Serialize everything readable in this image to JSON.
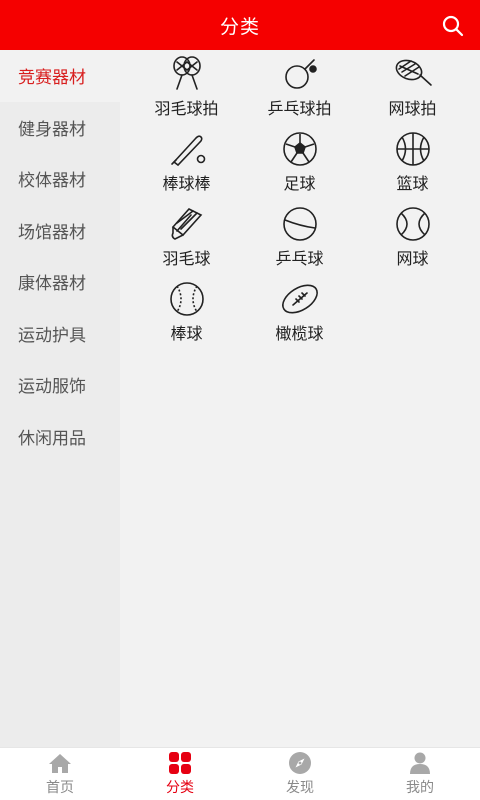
{
  "header": {
    "title": "分类",
    "search_icon": "search-icon"
  },
  "sidebar": {
    "items": [
      {
        "label": "竞赛器材",
        "active": true
      },
      {
        "label": "健身器材",
        "active": false
      },
      {
        "label": "校体器材",
        "active": false
      },
      {
        "label": "场馆器材",
        "active": false
      },
      {
        "label": "康体器材",
        "active": false
      },
      {
        "label": "运动护具",
        "active": false
      },
      {
        "label": "运动服饰",
        "active": false
      },
      {
        "label": "休闲用品",
        "active": false
      }
    ]
  },
  "categories": [
    {
      "label": "羽毛球拍",
      "icon": "badminton-racket-icon"
    },
    {
      "label": "乒乓球拍",
      "icon": "pingpong-paddle-icon"
    },
    {
      "label": "网球拍",
      "icon": "tennis-racket-icon"
    },
    {
      "label": "棒球棒",
      "icon": "baseball-bat-icon"
    },
    {
      "label": "足球",
      "icon": "soccer-ball-icon"
    },
    {
      "label": "篮球",
      "icon": "basketball-icon"
    },
    {
      "label": "羽毛球",
      "icon": "shuttlecock-icon"
    },
    {
      "label": "乒乓球",
      "icon": "pingpong-ball-icon"
    },
    {
      "label": "网球",
      "icon": "tennis-ball-icon"
    },
    {
      "label": "棒球",
      "icon": "baseball-icon"
    },
    {
      "label": "橄榄球",
      "icon": "rugby-ball-icon"
    }
  ],
  "tabbar": {
    "tabs": [
      {
        "label": "首页",
        "icon": "home-icon",
        "active": false
      },
      {
        "label": "分类",
        "icon": "category-grid-icon",
        "active": true
      },
      {
        "label": "发现",
        "icon": "compass-icon",
        "active": false
      },
      {
        "label": "我的",
        "icon": "user-icon",
        "active": false
      }
    ]
  },
  "colors": {
    "brand": "#f50000",
    "active_text": "#d81e1e",
    "tab_active": "#e60012"
  }
}
